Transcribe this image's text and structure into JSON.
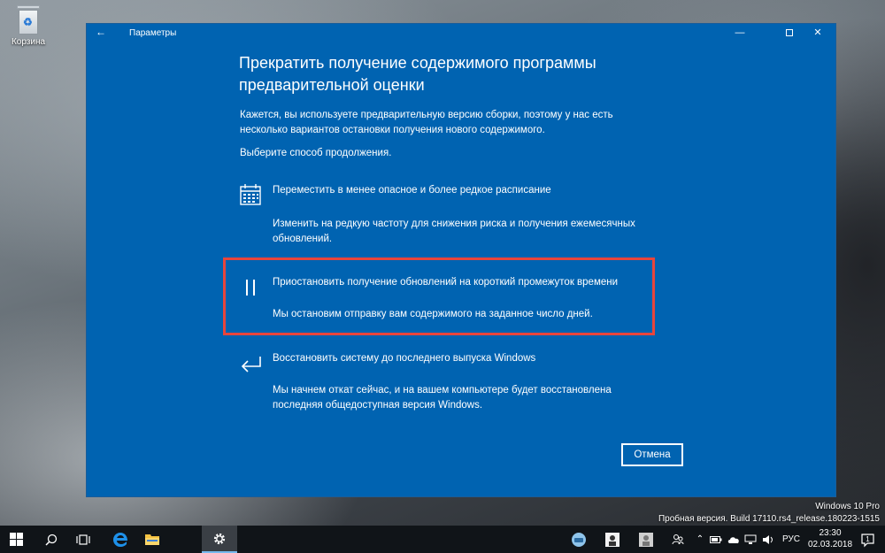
{
  "desktop": {
    "recycle_bin_label": "Корзина"
  },
  "window": {
    "title": "Параметры",
    "back_glyph": "←",
    "minimize_glyph": "—",
    "close_glyph": "✕"
  },
  "page": {
    "title": "Прекратить получение содержимого программы предварительной оценки",
    "description": "Кажется, вы используете предварительную версию сборки, поэтому у нас есть несколько вариантов остановки получения нового содержимого.",
    "choose_prompt": "Выберите способ продолжения.",
    "options": [
      {
        "title": "Переместить в менее опасное и более редкое расписание",
        "description": "Изменить на редкую частоту для снижения риска и получения ежемесячных обновлений.",
        "icon": "calendar-icon"
      },
      {
        "title": "Приостановить получение обновлений на короткий промежуток времени",
        "description": "Мы остановим отправку вам содержимого на заданное число дней.",
        "icon": "pause-icon"
      },
      {
        "title": "Восстановить систему до последнего выпуска Windows",
        "description": "Мы начнем откат сейчас, и на вашем компьютере будет восстановлена последняя общедоступная версия Windows.",
        "icon": "return-arrow-icon"
      }
    ],
    "cancel_label": "Отмена"
  },
  "watermark": {
    "line1": "Windows 10 Pro",
    "line2": "Пробная версия. Build 17110.rs4_release.180223-1515"
  },
  "taskbar": {
    "language": "РУС",
    "time": "23:30",
    "date": "02.03.2018",
    "notification_count": "1"
  },
  "colors": {
    "window_bg": "#0063b1",
    "highlight_border": "#e8453c",
    "taskbar_bg": "#101418"
  }
}
